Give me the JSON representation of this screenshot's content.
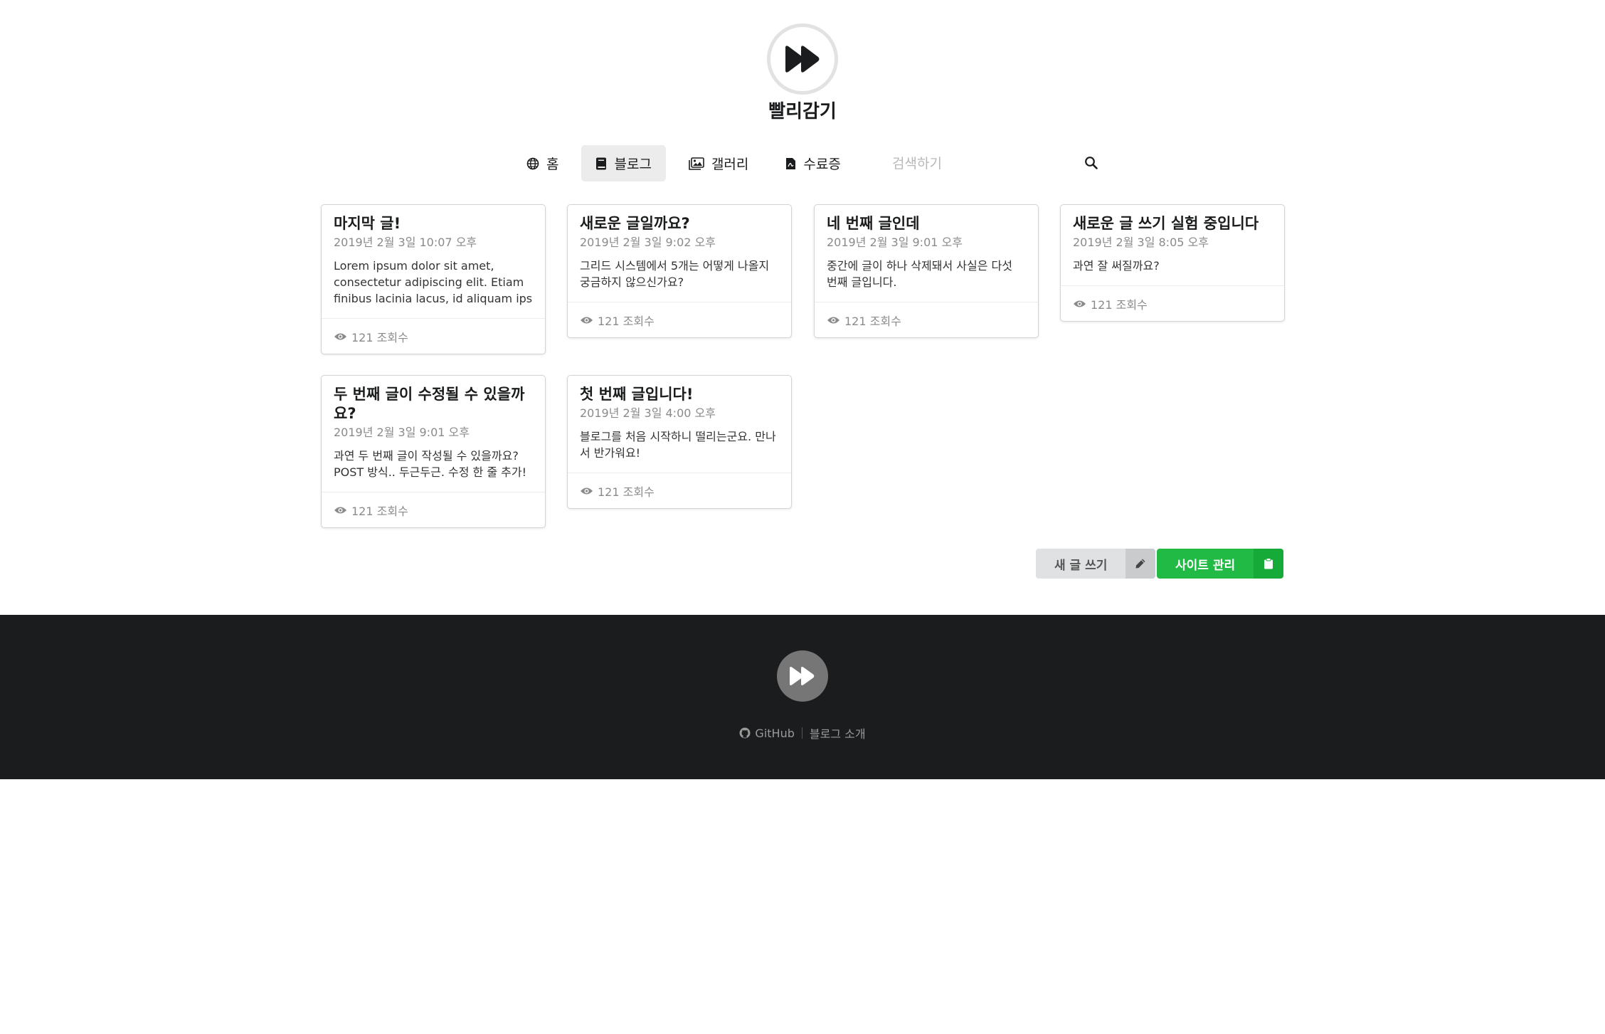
{
  "site": {
    "title": "빨리감기"
  },
  "menu": {
    "items": [
      {
        "label": "홈",
        "icon": "globe-icon"
      },
      {
        "label": "블로그",
        "icon": "book-icon",
        "active": true
      },
      {
        "label": "갤러리",
        "icon": "images-icon"
      },
      {
        "label": "수료증",
        "icon": "file-pdf-icon"
      }
    ],
    "search_placeholder": "검색하기"
  },
  "posts": [
    {
      "title": "마지막 글!",
      "date": "2019년 2월 3일 10:07 오후",
      "excerpt": "Lorem ipsum dolor sit amet, consectetur adipiscing elit. Etiam finibus lacinia lacus, id aliquam ips",
      "views": "121 조회수"
    },
    {
      "title": "새로운 글일까요?",
      "date": "2019년 2월 3일 9:02 오후",
      "excerpt": "그리드 시스템에서 5개는 어떻게 나올지 궁금하지 않으신가요?",
      "views": "121 조회수"
    },
    {
      "title": "네 번째 글인데",
      "date": "2019년 2월 3일 9:01 오후",
      "excerpt": "중간에 글이 하나 삭제돼서 사실은 다섯 번째 글입니다.",
      "views": "121 조회수"
    },
    {
      "title": "새로운 글 쓰기 실험 중입니다",
      "date": "2019년 2월 3일 8:05 오후",
      "excerpt": "과연 잘 써질까요?",
      "views": "121 조회수"
    },
    {
      "title": "두 번째 글이 수정될 수 있을까요?",
      "date": "2019년 2월 3일 9:01 오후",
      "excerpt": "과연 두 번째 글이 작성될 수 있을까요? POST 방식.. 두근두근. 수정 한 줄 추가!",
      "views": "121 조회수"
    },
    {
      "title": "첫 번째 글입니다!",
      "date": "2019년 2월 3일 4:00 오후",
      "excerpt": "블로그를 처음 시작하니 떨리는군요. 만나서 반가워요!",
      "views": "121 조회수"
    }
  ],
  "actions": {
    "new_post": "새 글 쓰기",
    "admin": "사이트 관리"
  },
  "footer": {
    "github": "GitHub",
    "about": "블로그 소개"
  },
  "colors": {
    "accent_green": "#21ba45",
    "footer_bg": "#1b1c1d",
    "active_menu_bg": "#ececec"
  }
}
